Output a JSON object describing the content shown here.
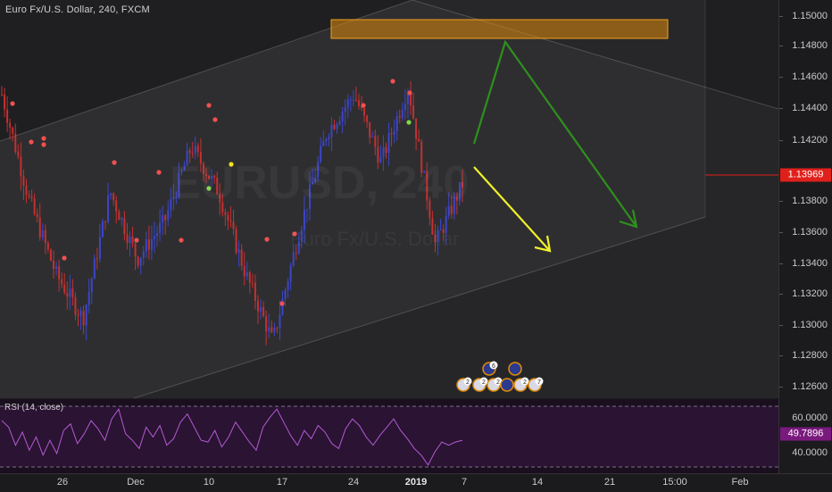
{
  "chart_title": "Euro Fx/U.S. Dollar, 240, FXCM",
  "watermark": "EURUSD, 240",
  "watermark_sub": "Euro Fx/U.S. Dollar",
  "price_axis": [
    "1.15000",
    "1.14800",
    "1.14600",
    "1.14400",
    "1.14200",
    "1.13800",
    "1.13600",
    "1.13400",
    "1.13200",
    "1.13000",
    "1.12800",
    "1.12600"
  ],
  "current_price": "1.13969",
  "rsi": {
    "title": "RSI (14, close)",
    "ticks": [
      "60.0000",
      "40.0000"
    ],
    "current": "49.7896"
  },
  "time_axis": [
    "26",
    "Dec",
    "10",
    "17",
    "24",
    "2019",
    "7",
    "14",
    "21",
    "15:00",
    "Feb"
  ],
  "event_badges": [
    "6",
    "2",
    "2",
    "2",
    "2",
    "7"
  ],
  "colors": {
    "bull": "#3b46c9",
    "bear": "#c23131",
    "channel": "#ffffff",
    "zone": "#e08a0b",
    "arrow_green": "#2f8f1e",
    "arrow_yellow": "#f0f02a",
    "rsi_line": "#b25bd3"
  },
  "chart_data": [
    {
      "type": "line",
      "name": "EURUSD 240 price (approx. close path)",
      "x": [
        0,
        30,
        60,
        90,
        120,
        150,
        180,
        210,
        240,
        270,
        300,
        330,
        360,
        390,
        420,
        450,
        480,
        510
      ],
      "y": [
        1.1455,
        1.1385,
        1.1335,
        1.1305,
        1.139,
        1.1345,
        1.137,
        1.142,
        1.139,
        1.1335,
        1.129,
        1.1365,
        1.143,
        1.1455,
        1.141,
        1.146,
        1.1355,
        1.1395
      ],
      "ylim": [
        1.1252,
        1.1518
      ],
      "markers_high": [
        1.1437,
        1.1421,
        1.1419,
        1.1412,
        1.1388,
        1.1356,
        1.1354,
        1.1356,
        1.138,
        1.1438,
        1.143,
        1.1457,
        1.1452,
        1.143
      ],
      "markers_low": [
        1.1347,
        1.1318,
        1.1309,
        1.1401,
        1.1352
      ]
    },
    {
      "type": "line",
      "name": "RSI",
      "ylim": [
        30,
        75
      ],
      "values": [
        62,
        58,
        47,
        55,
        44,
        52,
        41,
        50,
        42,
        56,
        60,
        48,
        54,
        62,
        57,
        50,
        63,
        69,
        54,
        50,
        45,
        58,
        52,
        59,
        47,
        51,
        61,
        66,
        58,
        50,
        49,
        56,
        46,
        52,
        61,
        55,
        49,
        44,
        58,
        64,
        69,
        61,
        53,
        47,
        56,
        51,
        59,
        55,
        48,
        45,
        57,
        63,
        59,
        52,
        47,
        53,
        58,
        63,
        56,
        51,
        45,
        41,
        35,
        43,
        49,
        47,
        49,
        50
      ]
    }
  ]
}
